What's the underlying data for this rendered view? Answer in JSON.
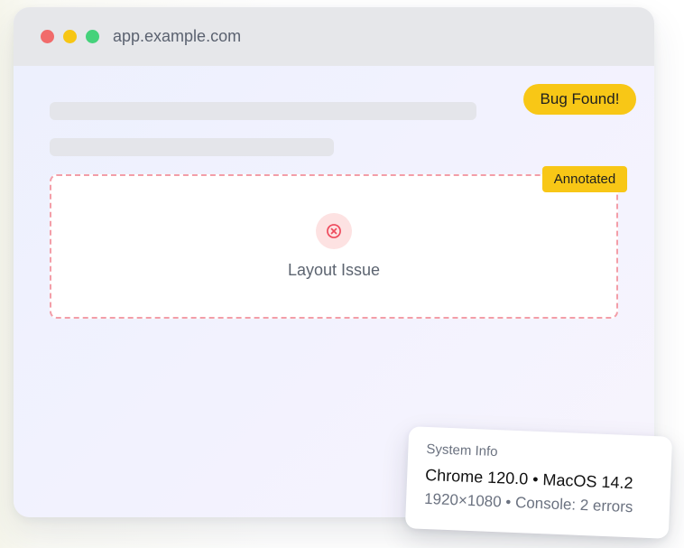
{
  "browser": {
    "url": "app.example.com",
    "window_controls": [
      {
        "name": "close",
        "color": "#f16b6b"
      },
      {
        "name": "minimize",
        "color": "#f7c614"
      },
      {
        "name": "maximize",
        "color": "#45d27b"
      }
    ]
  },
  "badges": {
    "bug_found": "Bug Found!",
    "annotated": "Annotated",
    "accent": "#f8c716"
  },
  "issue": {
    "label": "Layout Issue",
    "icon": "x-circle-icon",
    "color": "#f16b78"
  },
  "system_info": {
    "title": "System Info",
    "browser_os": "Chrome 120.0 • MacOS 14.2",
    "details": "1920×1080 • Console: 2 errors"
  }
}
